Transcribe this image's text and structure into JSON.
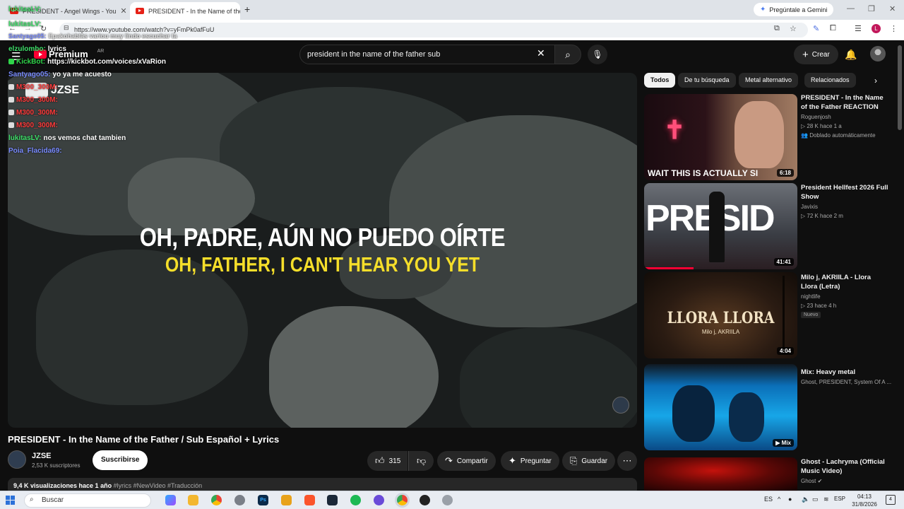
{
  "browser": {
    "tabs": [
      {
        "label": "PRESIDENT - Angel Wings - You",
        "active": false
      },
      {
        "label": "PRESIDENT - In the Name of the",
        "active": true
      }
    ],
    "gemini_button": "Pregúntale a Gemini",
    "url": "https://www.youtube.com/watch?v=yFmPk0afFuU",
    "profile_letter": "L"
  },
  "youtube": {
    "logo_text": "Premium",
    "country_code": "AR",
    "search_query": "president in the name of the father  sub",
    "create_label": "Crear"
  },
  "chat": [
    {
      "user": "lukitasLV:",
      "text": "",
      "color": "#3fe06a"
    },
    {
      "user": "lukitasLV:",
      "text": "",
      "color": "#3fe06a"
    },
    {
      "user": "Santyago05:",
      "text": "Epakohablás variou muy lindo escuchar la",
      "color": "#7a8cff"
    },
    {
      "user": "elzulombo:",
      "text": "lyrics",
      "color": "#3fe06a"
    },
    {
      "user": "KickBot:",
      "text": "https://kickbot.com/voices/xVaRion",
      "color": "#2fd54a"
    },
    {
      "user": "Santyago05:",
      "text": "yo ya me acuesto",
      "color": "#7a8cff"
    },
    {
      "user": "M300_300M:",
      "text": "",
      "color": "#ff3b3b"
    },
    {
      "user": "M300_300M:",
      "text": "",
      "color": "#ff3b3b"
    },
    {
      "user": "M300_300M:",
      "text": "",
      "color": "#ff3b3b"
    },
    {
      "user": "M300_300M:",
      "text": "",
      "color": "#ff3b3b"
    },
    {
      "user": "lukitasLV:",
      "text": "nos vemos chat tambien",
      "color": "#3fe06a"
    },
    {
      "user": "Poia_Flacida69:",
      "text": "",
      "color": "#7a8cff"
    }
  ],
  "player": {
    "watermark_name": "JZSE",
    "lyric_spanish": "OH, PADRE, AÚN NO PUEDO OÍRTE",
    "lyric_english": "OH, FATHER, I CAN'T HEAR YOU YET"
  },
  "video": {
    "title": "PRESIDENT - In the Name of the Father / Sub Español + Lyrics",
    "channel": "JZSE",
    "subscribers": "2,53 K suscriptores",
    "subscribe_label": "Suscribirse",
    "likes": "315",
    "share_label": "Compartir",
    "ask_label": "Preguntar",
    "save_label": "Guardar",
    "views_date": "9,4 K visualizaciones  hace 1 año",
    "hashtags": "#lyrics #NewVideo #Traducción"
  },
  "sidebar": {
    "chips": [
      "Todos",
      "De tu búsqueda",
      "Metal alternativo",
      "Relacionados"
    ],
    "cards": [
      {
        "title": "PRESIDENT - In the Name of the Father REACTION",
        "channel": "Roguenjosh",
        "meta": "28 K  hace 1 a",
        "badge": "Doblado automáticamente",
        "duration": "6:18",
        "thumb_text": "WAIT THIS IS ACTUALLY SI"
      },
      {
        "title": "President Hellfest 2026 Full Show",
        "channel": "Javixis",
        "meta": "72 K  hace 2 m",
        "badge": "",
        "duration": "41:41",
        "thumb_text": "PRESID"
      },
      {
        "title": "Milo j, AKRIILA - Llora Llora (Letra)",
        "channel": "nightlife",
        "meta": "23  hace 4 h",
        "badge": "Nuevo",
        "duration": "4:04",
        "thumb_text": "LLORA LLORA",
        "thumb_sub": "Milo j, AKRIILA"
      },
      {
        "title": "Mix: Heavy metal",
        "channel": "Ghost, PRESIDENT, System Of A ...",
        "meta": "",
        "badge": "",
        "duration": "Mix",
        "thumb_text": ""
      },
      {
        "title": "Ghost - Lachryma (Official Music Video)",
        "channel": "Ghost",
        "meta": "",
        "badge": "",
        "duration": "",
        "thumb_text": ""
      }
    ]
  },
  "taskbar": {
    "search_label": "Buscar",
    "language": "ES",
    "kb_lang": "ESP",
    "time": "04:13",
    "date": "31/8/2026",
    "notif_count": "4"
  }
}
